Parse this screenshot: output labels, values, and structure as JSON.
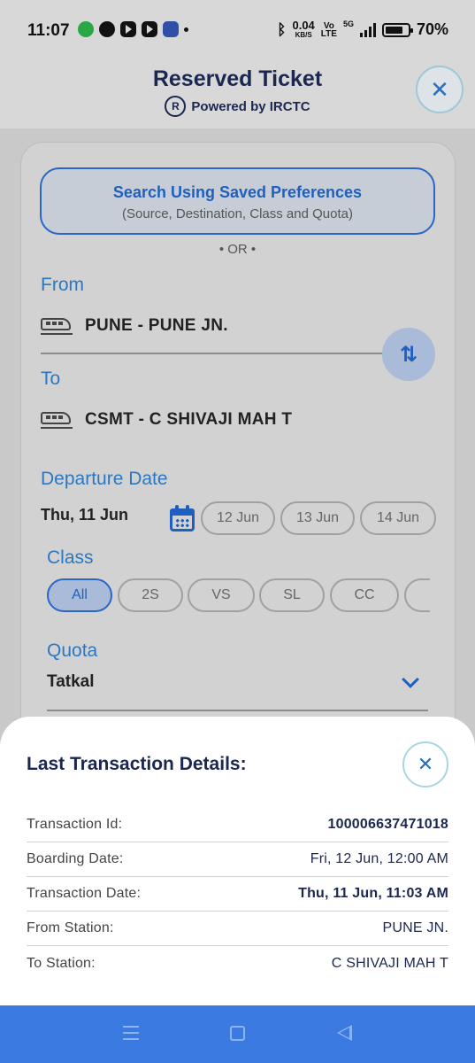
{
  "status_bar": {
    "time": "11:07",
    "net_speed": "0.04",
    "net_unit": "KB/S",
    "volte": "Vo",
    "lte": "LTE",
    "signal_gen": "5G",
    "battery": "70%",
    "app_icons": [
      "whatsapp-icon",
      "chat-icon",
      "youtube-icon",
      "youtube-icon",
      "rail-app-icon"
    ]
  },
  "header": {
    "title": "Reserved Ticket",
    "powered_by": "Powered by IRCTC",
    "close": "✕"
  },
  "search_form": {
    "saved_pref_title": "Search Using Saved Preferences",
    "saved_pref_subtitle": "(Source, Destination, Class and Quota)",
    "or_text": "•   OR   •",
    "from_label": "From",
    "from_value": "PUNE - PUNE JN.",
    "to_label": "To",
    "to_value": "CSMT - C SHIVAJI MAH T",
    "swap_icon": "⇅",
    "departure_label": "Departure Date",
    "departure_selected": "Thu, 11 Jun",
    "date_options": [
      "12 Jun",
      "13 Jun",
      "14 Jun"
    ],
    "class_label": "Class",
    "class_options": [
      "All",
      "2S",
      "VS",
      "SL",
      "CC"
    ],
    "class_selected": "All",
    "quota_label": "Quota",
    "quota_value": "Tatkal"
  },
  "last_transaction": {
    "title": "Last Transaction Details:",
    "close": "✕",
    "rows": [
      {
        "label": "Transaction Id:",
        "value": "100006637471018"
      },
      {
        "label": "Boarding Date:",
        "value": "Fri, 12 Jun, 12:00 AM"
      },
      {
        "label": "Transaction Date:",
        "value": "Thu, 11 Jun, 11:03 AM"
      },
      {
        "label": "From Station:",
        "value": "PUNE JN."
      },
      {
        "label": "To Station:",
        "value": "C SHIVAJI MAH T"
      }
    ]
  },
  "colors": {
    "accent": "#1f5fc0",
    "title_navy": "#1c2750",
    "label_blue": "#2a78c4",
    "nav_bar": "#3b7ae0"
  }
}
